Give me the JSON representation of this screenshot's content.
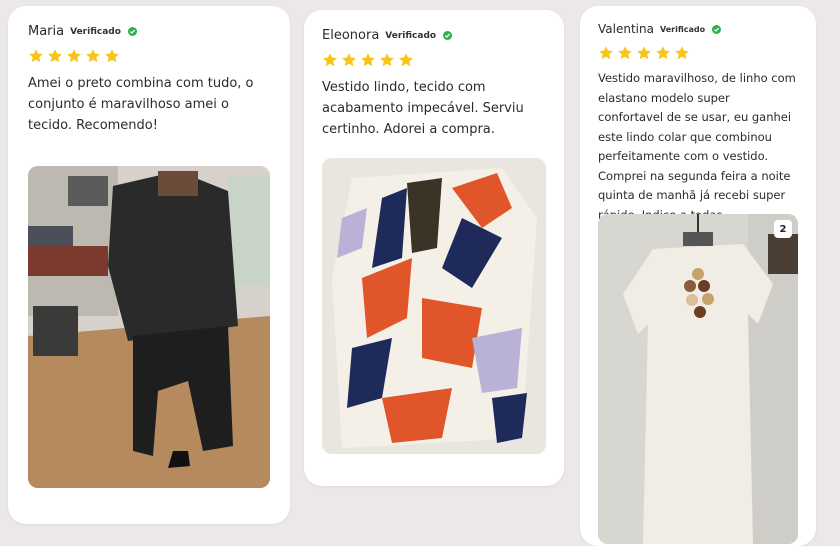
{
  "reviews": [
    {
      "name": "Maria",
      "verified_label": "Verificado",
      "rating": 5,
      "text": "Amei o preto combina com tudo, o conjunto é maravilhoso amei o tecido. Recomendo!"
    },
    {
      "name": "Eleonora",
      "verified_label": "Verificado",
      "rating": 5,
      "text": "Vestido lindo, tecido com acabamento impecável. Serviu certinho. Adorei a compra."
    },
    {
      "name": "Valentina",
      "verified_label": "Verificado",
      "rating": 5,
      "text": "Vestido maravilhoso, de linho com elastano modelo super confortavel de se usar, eu ganhei este lindo colar que combinou perfeitamente com o vestido. Comprei na segunda feira a noite quinta de manhã já recebi super rápido. Indico a todas",
      "photo_count": "2"
    }
  ],
  "colors": {
    "star": "#f5c518",
    "verified": "#2bb24c",
    "background": "#ede8e8",
    "card": "#ffffff"
  },
  "icons": {
    "star": "star-icon",
    "verified": "verified-check-icon"
  }
}
